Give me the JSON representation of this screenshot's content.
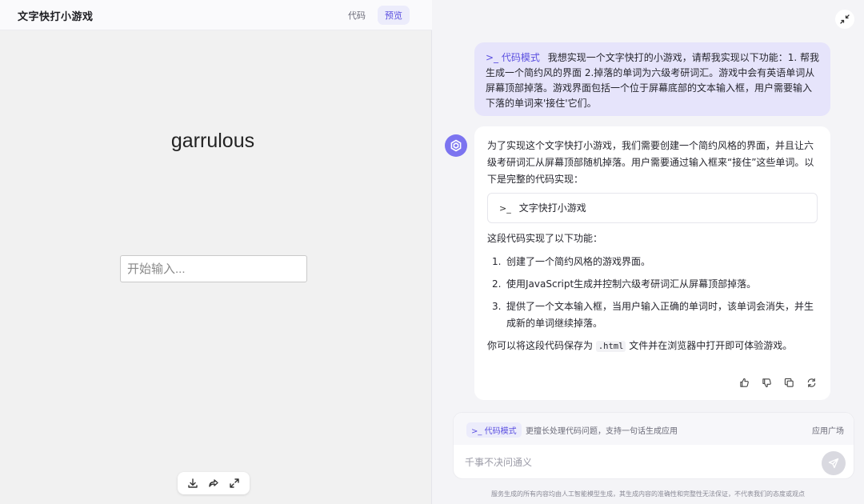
{
  "left_panel": {
    "title": "文字快打小游戏",
    "tabs": [
      {
        "label": "代码",
        "active": false
      },
      {
        "label": "预览",
        "active": true
      }
    ],
    "falling_word": "garrulous",
    "input_placeholder": "开始输入...",
    "toolbar_icons": [
      "download-icon",
      "share-icon",
      "expand-icon"
    ]
  },
  "right_panel": {
    "user_message": {
      "mode_label": "代码模式",
      "text": "我想实现一个文字快打的小游戏，请帮我实现以下功能：1. 帮我生成一个简约风的界面 2.掉落的单词为六级考研词汇。游戏中会有英语单词从屏幕顶部掉落。游戏界面包括一个位于屏幕底部的文本输入框，用户需要输入下落的单词来'接住'它们。"
    },
    "bot_message": {
      "intro": "为了实现这个文字快打小游戏，我们需要创建一个简约风格的界面，并且让六级考研词汇从屏幕顶部随机掉落。用户需要通过输入框来“接住”这些单词。以下是完整的代码实现：",
      "code_card_title": "文字快打小游戏",
      "features_title": "这段代码实现了以下功能：",
      "features": [
        {
          "num": "1.",
          "text": "创建了一个简约风格的游戏界面。"
        },
        {
          "num": "2.",
          "text": "使用JavaScript生成并控制六级考研词汇从屏幕顶部掉落。"
        },
        {
          "num": "3.",
          "text": "提供了一个文本输入框，当用户输入正确的单词时，该单词会消失，并生成新的单词继续掉落。"
        }
      ],
      "closing_before": "你可以将这段代码保存为 ",
      "closing_code": ".html",
      "closing_after": " 文件并在浏览器中打开即可体验游戏。",
      "actions": [
        "thumbs-up-icon",
        "thumbs-down-icon",
        "copy-icon",
        "refresh-icon"
      ]
    },
    "composer": {
      "mode_chip": "代码模式",
      "mode_description": "更擅长处理代码问题，支持一句话生成应用",
      "app_square": "应用广场",
      "placeholder": "千事不决问通义"
    },
    "disclaimer": "服务生成的所有内容均由人工智能模型生成，其生成内容的准确性和完整性无法保证，不代表我们的态度或观点"
  },
  "colors": {
    "accent": "#5b4fe0",
    "user_bubble": "#e6e4fb",
    "avatar": "#7c74f0"
  }
}
